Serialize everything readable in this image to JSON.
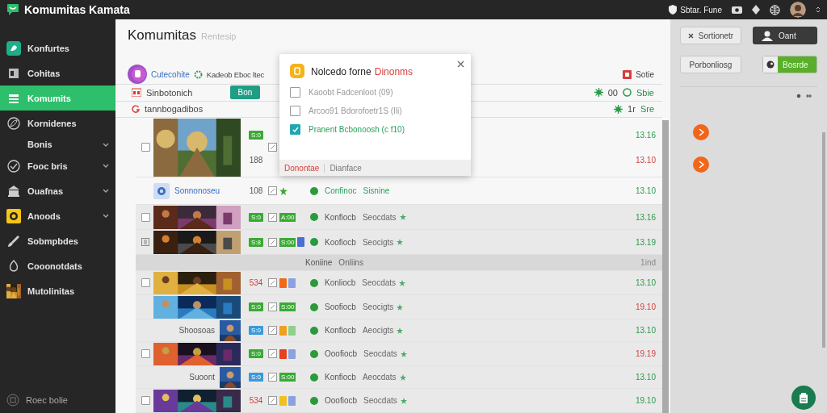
{
  "app": {
    "title": "Komumitas Kamata",
    "user": "Sbtar. Fune"
  },
  "sidebar": {
    "items": [
      {
        "label": "Konfurtes",
        "selected": false,
        "expandable": false
      },
      {
        "label": "Cohitas",
        "selected": false,
        "expandable": false
      },
      {
        "label": "Komumits",
        "selected": true,
        "expandable": false
      },
      {
        "label": "Kornidenes",
        "selected": false,
        "expandable": false
      },
      {
        "label": "Bonis",
        "selected": false,
        "expandable": true
      },
      {
        "label": "Fooc bris",
        "selected": false,
        "expandable": true
      },
      {
        "label": "Ouafnas",
        "selected": false,
        "expandable": true
      },
      {
        "label": "Anoods",
        "selected": false,
        "expandable": true
      },
      {
        "label": "Sobmpbdes",
        "selected": false,
        "expandable": false
      },
      {
        "label": "Cooonotdats",
        "selected": false,
        "expandable": false
      },
      {
        "label": "Mutolinitas",
        "selected": false,
        "expandable": false
      }
    ],
    "footer": "Roec bolie"
  },
  "page": {
    "title": "Komumitas",
    "subtitle": "Rentesip",
    "group": "Cutecohite",
    "group_info": "Kadeob Eboc ltec",
    "action": "Sotie"
  },
  "toolbar": {
    "label": "Sinbotonich",
    "button": "Bon",
    "stats": [
      "00",
      "Sbie"
    ]
  },
  "list_header": {
    "title": "tannbogadibos",
    "stats": [
      "1r",
      "Sre"
    ]
  },
  "rows": [
    {
      "kind": "item",
      "lead": {
        "kind": "checkbox",
        "checked": false
      },
      "thumb": {
        "kind": "wide"
      },
      "badge": {
        "text": "S:0",
        "kind": "fill",
        "color": "#3aaa35"
      },
      "count": "188",
      "icon": true,
      "times": [
        {
          "text": "13.16",
          "late": false
        },
        {
          "text": "13.10",
          "late": true
        }
      ]
    },
    {
      "kind": "item",
      "thumb": {
        "kind": "app",
        "caption": "Sonnonoseu"
      },
      "count": "108",
      "icon": true,
      "tags": [
        {
          "kind": "star",
          "color": "#3aaa35"
        }
      ],
      "online": true,
      "name": "Confinoc",
      "detail": "Sisnine",
      "highlight": true,
      "times": [
        {
          "text": "13.10",
          "late": false
        }
      ]
    },
    {
      "kind": "item",
      "lead": {
        "kind": "checkbox",
        "checked": false
      },
      "thumb": {
        "kind": "wide"
      },
      "badge": {
        "text": "S:0",
        "kind": "fill",
        "color": "#3aaa35"
      },
      "icon": true,
      "tags": [
        {
          "kind": "label",
          "text": "A:00",
          "color": "#3aaa35"
        }
      ],
      "online": true,
      "name": "Konfiocb",
      "detail": "Seocdats",
      "highlight": false,
      "starred": true,
      "times": [
        {
          "text": "13.16",
          "late": false
        }
      ]
    },
    {
      "kind": "item",
      "lead": {
        "kind": "icon"
      },
      "thumb": {
        "kind": "wide"
      },
      "badge": {
        "text": "S:8",
        "kind": "fill",
        "color": "#3aaa35"
      },
      "icon": true,
      "tags": [
        {
          "kind": "label",
          "text": "S:00",
          "color": "#3aaa35"
        },
        {
          "kind": "square",
          "color": "#4a6fd0"
        }
      ],
      "online": true,
      "name": "Koofiocb",
      "detail": "Seocigts",
      "highlight": false,
      "starred": true,
      "times": [
        {
          "text": "13.19",
          "late": false
        }
      ]
    },
    {
      "kind": "group",
      "name": "Koniine",
      "detail": "Onliins",
      "times": [
        {
          "text": "1ind",
          "late": false
        }
      ]
    },
    {
      "kind": "item",
      "lead": {
        "kind": "checkbox",
        "checked": false
      },
      "thumb": {
        "kind": "wide"
      },
      "badge": {
        "text": "534",
        "kind": "text",
        "color": "#d83b3b"
      },
      "icon": true,
      "tags": [
        {
          "kind": "square",
          "color": "#f06a1a"
        },
        {
          "kind": "square",
          "color": "#8aa2e0"
        }
      ],
      "online": true,
      "name": "Konliocb",
      "detail": "Seocdats",
      "highlight": false,
      "starred": true,
      "times": [
        {
          "text": "13.10",
          "late": false
        }
      ]
    },
    {
      "kind": "item",
      "thumb": {
        "kind": "wide"
      },
      "badge": {
        "text": "S:0",
        "kind": "fill",
        "color": "#3aaa35"
      },
      "icon": true,
      "tags": [
        {
          "kind": "label",
          "text": "S:00",
          "color": "#3aaa35"
        }
      ],
      "online": true,
      "name": "Soofiocb",
      "detail": "Seocigts",
      "highlight": false,
      "starred": true,
      "times": [
        {
          "text": "19.10",
          "late": true
        }
      ]
    },
    {
      "kind": "item",
      "thumb": {
        "kind": "small",
        "caption": "Shoosoas"
      },
      "badge": {
        "text": "S:0",
        "kind": "fill",
        "color": "#3a9ad9"
      },
      "icon": true,
      "tags": [
        {
          "kind": "square",
          "color": "#f0a020"
        },
        {
          "kind": "square",
          "color": "#8fd08a"
        }
      ],
      "online": true,
      "name": "Konfiocb",
      "detail": "Aeocigts",
      "highlight": false,
      "starred": true,
      "times": [
        {
          "text": "13.10",
          "late": false
        }
      ]
    },
    {
      "kind": "item",
      "lead": {
        "kind": "checkbox",
        "checked": false
      },
      "thumb": {
        "kind": "wide"
      },
      "badge": {
        "text": "S:0",
        "kind": "fill",
        "color": "#3aaa35"
      },
      "icon": true,
      "tags": [
        {
          "kind": "square",
          "color": "#e8401a"
        },
        {
          "kind": "square",
          "color": "#8aa2e0"
        }
      ],
      "online": true,
      "name": "Ooofiocb",
      "detail": "Seocdats",
      "highlight": false,
      "starred": true,
      "times": [
        {
          "text": "19.19",
          "late": true
        }
      ]
    },
    {
      "kind": "item",
      "thumb": {
        "kind": "small",
        "caption": "Suoont"
      },
      "badge": {
        "text": "S:0",
        "kind": "fill",
        "color": "#3a9ad9"
      },
      "icon": true,
      "tags": [
        {
          "kind": "label",
          "text": "S:00",
          "color": "#3aaa35"
        }
      ],
      "online": true,
      "name": "Konfiocb",
      "detail": "Aeocdats",
      "highlight": false,
      "starred": true,
      "times": [
        {
          "text": "13.10",
          "late": false
        }
      ]
    },
    {
      "kind": "item",
      "lead": {
        "kind": "checkbox",
        "checked": false
      },
      "thumb": {
        "kind": "wide"
      },
      "badge": {
        "text": "534",
        "kind": "text",
        "color": "#d83b3b"
      },
      "icon": true,
      "tags": [
        {
          "kind": "square",
          "color": "#f0c020"
        },
        {
          "kind": "square",
          "color": "#8aa2e0"
        }
      ],
      "online": true,
      "name": "Ooofiocb",
      "detail": "Seocdats",
      "highlight": false,
      "starred": true,
      "times": [
        {
          "text": "19.10",
          "late": false
        }
      ]
    }
  ],
  "dialog": {
    "title": "Nolcedo forne",
    "title_accent": "Dinonms",
    "options": [
      {
        "label": "Kaoobt Fadcenloot (09)",
        "checked": false
      },
      {
        "label": "Arcoo91 Bdorofoetr1S (Ili)",
        "checked": false
      },
      {
        "label": "Pranent Bcbonoosh (c f10)",
        "checked": true
      }
    ],
    "primary": "Donontae",
    "secondary": "Dianface"
  },
  "side_panel": {
    "buttons": [
      {
        "label": "Sortionetr",
        "kind": "dismiss"
      },
      {
        "label": "Oant",
        "kind": "dark"
      },
      {
        "label": "Porbonliosg",
        "kind": "outline"
      },
      {
        "label": "Bosrde",
        "kind": "toggle"
      }
    ]
  }
}
